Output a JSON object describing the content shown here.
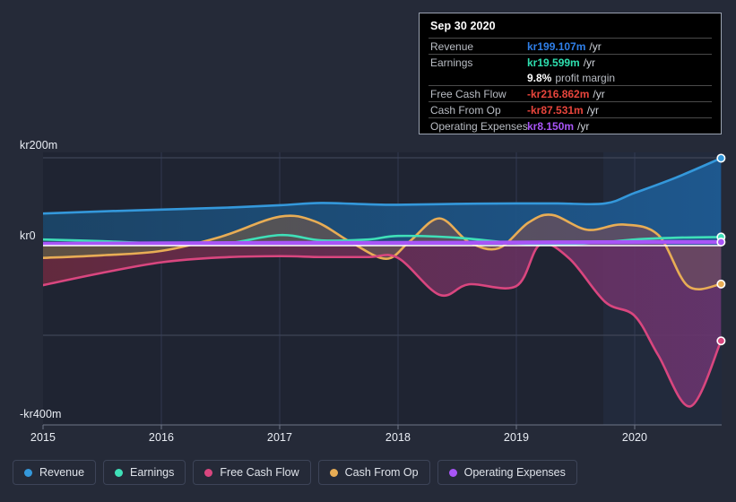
{
  "tooltip": {
    "date": "Sep 30 2020",
    "rows": [
      {
        "name": "Revenue",
        "value": "kr199.107m",
        "unit": "/yr",
        "color": "#2f7fe8"
      },
      {
        "name": "Earnings",
        "value": "kr19.599m",
        "unit": "/yr",
        "color": "#2ee0b0"
      },
      {
        "name": "",
        "value": "9.8%",
        "unit": "profit margin",
        "color": "#ffffff"
      },
      {
        "name": "Free Cash Flow",
        "value": "-kr216.862m",
        "unit": "/yr",
        "color": "#e8453c"
      },
      {
        "name": "Cash From Op",
        "value": "-kr87.531m",
        "unit": "/yr",
        "color": "#e8453c"
      },
      {
        "name": "Operating Expenses",
        "value": "kr8.150m",
        "unit": "/yr",
        "color": "#a855f7"
      }
    ]
  },
  "legend": {
    "items": [
      {
        "label": "Revenue",
        "color": "#3498db"
      },
      {
        "label": "Earnings",
        "color": "#3fe0b8"
      },
      {
        "label": "Free Cash Flow",
        "color": "#d9467f"
      },
      {
        "label": "Cash From Op",
        "color": "#e8ad55"
      },
      {
        "label": "Operating Expenses",
        "color": "#a855f7"
      }
    ]
  },
  "chart_data": {
    "type": "area",
    "title": "",
    "xlabel": "",
    "ylabel": "",
    "currency": "kr",
    "y_ticks": [
      "kr200m",
      "kr0",
      "-kr400m"
    ],
    "y_tick_values": [
      200,
      0,
      -400
    ],
    "ylim": [
      -400,
      260
    ],
    "grid": true,
    "x_ticks": [
      "2015",
      "2016",
      "2017",
      "2018",
      "2019",
      "2020"
    ],
    "x_tick_values": [
      2015,
      2016,
      2017,
      2018,
      2019,
      2020
    ],
    "xlim": [
      2015,
      2020.73
    ],
    "legend_position": "bottom",
    "highlight_date": "Sep 30 2020",
    "series": [
      {
        "name": "Revenue",
        "color": "#3498db",
        "fill": "#1d4a72",
        "x": [
          2015,
          2015.5,
          2016,
          2016.5,
          2017,
          2017.35,
          2017.75,
          2018,
          2018.5,
          2019,
          2019.35,
          2019.75,
          2020,
          2020.35,
          2020.73
        ],
        "values": [
          73,
          78,
          82,
          86,
          92,
          97,
          94,
          93,
          95,
          96,
          96,
          96,
          120,
          155,
          199.107
        ]
      },
      {
        "name": "Earnings",
        "color": "#3fe0b8",
        "x": [
          2015,
          2015.5,
          2016,
          2016.5,
          2017,
          2017.35,
          2017.75,
          2018,
          2018.5,
          2019,
          2019.35,
          2019.75,
          2020,
          2020.35,
          2020.73
        ],
        "values": [
          14,
          10,
          5,
          3,
          24,
          12,
          14,
          22,
          18,
          5,
          2,
          8,
          14,
          18,
          19.599
        ]
      },
      {
        "name": "Free Cash Flow",
        "color": "#d9467f",
        "fill": "#6e2540",
        "x": [
          2015,
          2015.5,
          2016,
          2016.5,
          2017,
          2017.35,
          2017.75,
          2018,
          2018.35,
          2018.6,
          2019,
          2019.2,
          2019.45,
          2019.75,
          2020,
          2020.2,
          2020.47,
          2020.73
        ],
        "values": [
          -90,
          -62,
          -38,
          -27,
          -24,
          -26,
          -26,
          -28,
          -112,
          -88,
          -92,
          2,
          -30,
          -128,
          -160,
          -250,
          -366,
          -216.862
        ]
      },
      {
        "name": "Cash From Op",
        "color": "#e8ad55",
        "fill": "#5c5b42",
        "x": [
          2015,
          2015.5,
          2016,
          2016.5,
          2017,
          2017.3,
          2017.6,
          2017.9,
          2018.1,
          2018.35,
          2018.6,
          2018.85,
          2019.1,
          2019.3,
          2019.6,
          2019.9,
          2020.2,
          2020.45,
          2020.73
        ],
        "values": [
          -28,
          -22,
          -12,
          20,
          66,
          55,
          8,
          -30,
          10,
          62,
          8,
          -6,
          52,
          70,
          36,
          48,
          24,
          -92,
          -87.531
        ]
      },
      {
        "name": "Operating Expenses",
        "color": "#a855f7",
        "x": [
          2015,
          2016,
          2017,
          2018,
          2019,
          2020,
          2020.73
        ],
        "values": [
          4,
          5,
          6,
          6,
          7,
          8,
          8.15
        ]
      }
    ]
  }
}
